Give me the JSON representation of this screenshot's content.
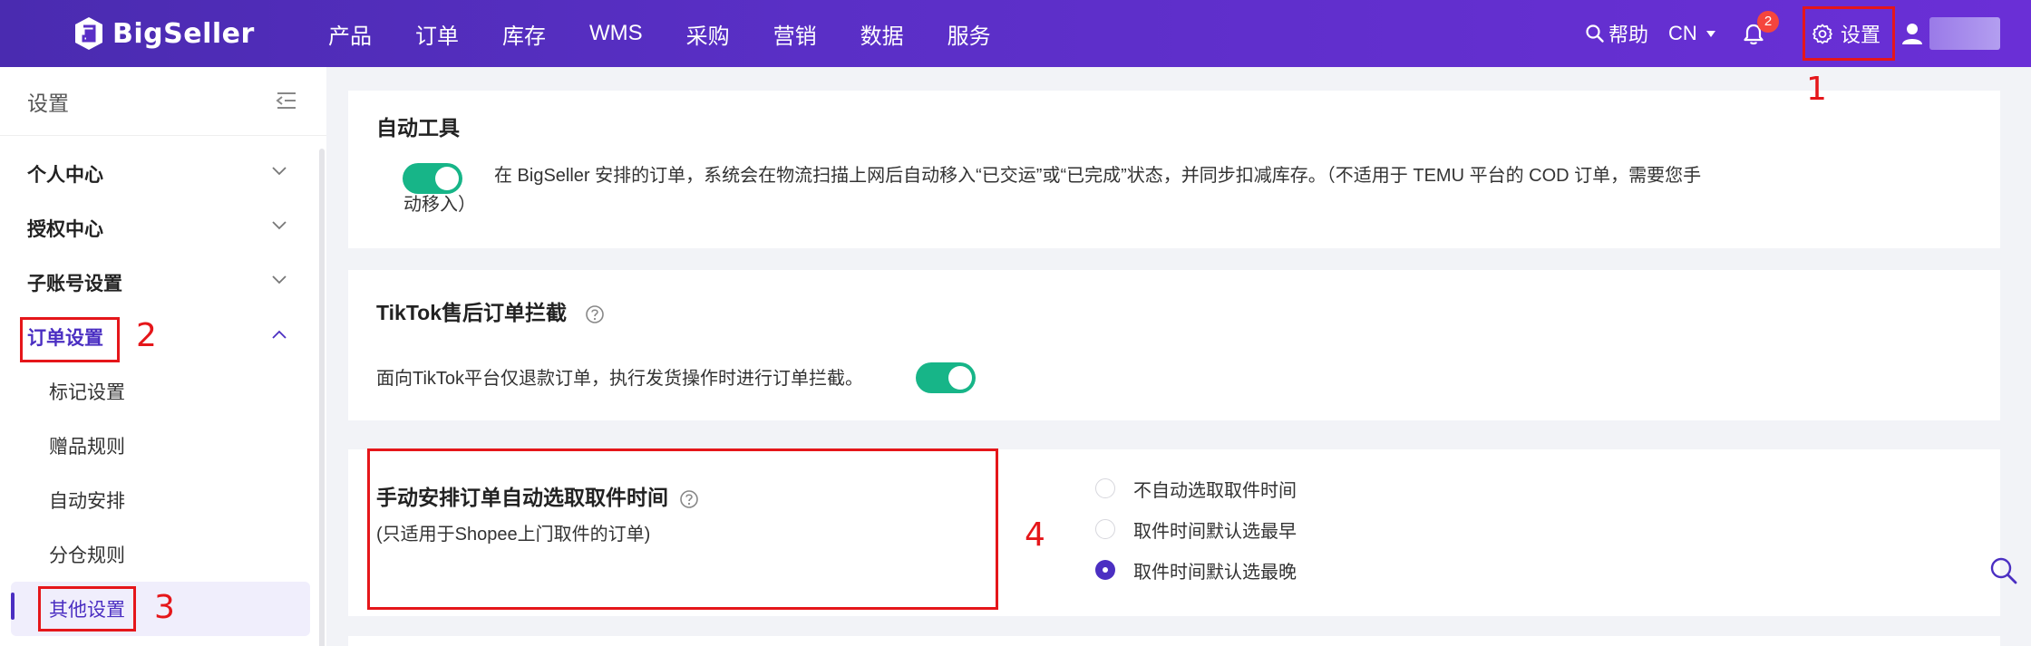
{
  "app": {
    "logo_text": "BigSeller",
    "nav": [
      "产品",
      "订单",
      "库存",
      "WMS",
      "采购",
      "营销",
      "数据",
      "服务"
    ],
    "help_label": "帮助",
    "lang_label": "CN",
    "notification_count": "2",
    "settings_label": "设置",
    "brand_color": "#5a2fc6"
  },
  "sidebar": {
    "title": "设置",
    "menu": [
      {
        "label": "个人中心",
        "expanded": false
      },
      {
        "label": "授权中心",
        "expanded": false
      },
      {
        "label": "子账号设置",
        "expanded": false
      },
      {
        "label": "订单设置",
        "expanded": true
      }
    ],
    "sub_items": [
      "标记设置",
      "赠品规则",
      "自动安排",
      "分仓规则",
      "其他设置"
    ],
    "active_sub": "其他设置"
  },
  "main": {
    "auto_tool": {
      "title": "自动工具",
      "toggle_on": true,
      "desc_line1": "在 BigSeller 安排的订单，系统会在物流扫描上网后自动移入“已交运”或“已完成”状态，并同步扣减库存。（不适用于 TEMU 平台的 COD 订单，需要您手",
      "desc_line2": "动移入）"
    },
    "tiktok": {
      "title": "TikTok售后订单拦截",
      "desc": "面向TikTok平台仅退款订单，执行发货操作时进行订单拦截。",
      "toggle_on": true
    },
    "pickup": {
      "title": "手动安排订单自动选取取件时间",
      "subtitle": "(只适用于Shopee上门取件的订单)",
      "options": [
        "不自动选取取件时间",
        "取件时间默认选最早",
        "取件时间默认选最晚"
      ],
      "selected": "取件时间默认选最晚"
    }
  },
  "annotations": [
    "1",
    "2",
    "3",
    "4"
  ],
  "colors": {
    "accent": "#4b2fc2",
    "toggle_on": "#17b588",
    "annotation_red": "#e5161a",
    "badge_red": "#f5453d"
  }
}
